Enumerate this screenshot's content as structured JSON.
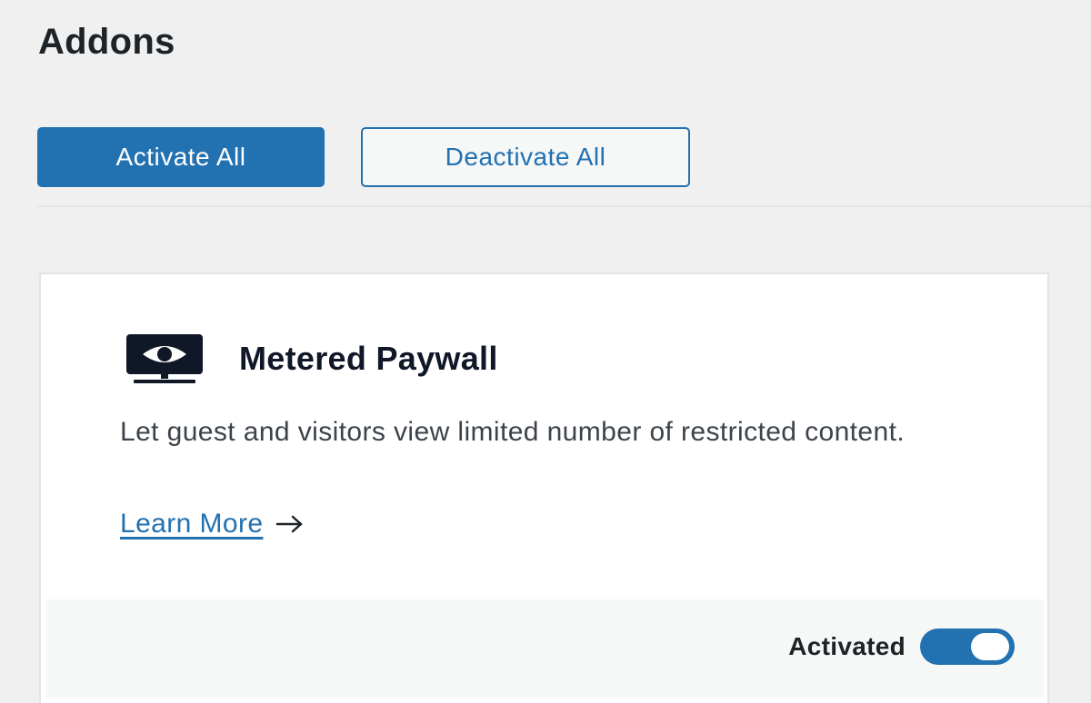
{
  "page": {
    "title": "Addons"
  },
  "actions": {
    "activate_all_label": "Activate All",
    "deactivate_all_label": "Deactivate All"
  },
  "addon": {
    "icon": "monitor-eye-icon",
    "title": "Metered Paywall",
    "description": "Let guest and visitors view limited number of restricted content.",
    "learn_more_label": "Learn More",
    "learn_more_icon": "arrow-right-icon",
    "status_label": "Activated",
    "enabled": true
  },
  "colors": {
    "accent": "#2271b1",
    "page_background": "#f0f0f1",
    "card_background": "#ffffff",
    "footer_background": "#f6f7f7",
    "title_text": "#101828"
  }
}
